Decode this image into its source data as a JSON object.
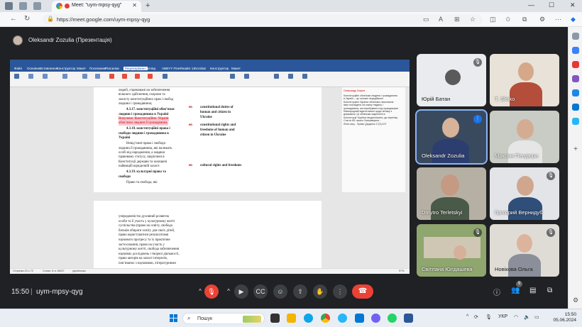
{
  "browser": {
    "tab_title": "Meet: \"uym-mpsy-qyg\"",
    "url": "https://meet.google.com/uym-mpsy-qyg"
  },
  "meet": {
    "presenter_label": "Oleksandr Zozulia (Презентація)",
    "time": "15:50",
    "separator": "|",
    "meeting_code": "uym-mpsy-qyg",
    "participants_count": "9",
    "participants": [
      {
        "name": "Юрій Батан",
        "muted": true
      },
      {
        "name": "T. Slinko",
        "muted": false
      },
      {
        "name": "Oleksandr Zozulia",
        "muted": false
      },
      {
        "name": "Максим Пендюра",
        "muted": false
      },
      {
        "name": "Dmytro Terletskyi",
        "muted": false
      },
      {
        "name": "Григорий Вернидуб",
        "muted": true
      },
      {
        "name": "Світлана Юлдашева",
        "muted": true
      },
      {
        "name": "Новікова Ольга",
        "muted": true
      }
    ]
  },
  "shared_doc": {
    "ribbon_tabs": [
      "Файл",
      "Основне",
      "Вставлення",
      "Конструктор",
      "Макет",
      "Посилання",
      "Розсилки",
      "Рецензування",
      "Вигляд",
      "ABBYY FineReader 12",
      "Acrobat",
      "Конструктор",
      "Макет"
    ],
    "active_tab_index": 7,
    "page1_lines": [
      "людей, спрямовані на забезпечення",
      "вільного здійснення, охорони та",
      "захисту конституційних прав і свобод",
      "людини і громадянина;",
      "4.3.17. конституційні обов’язки",
      "людини і громадянина в Україні",
      "Вилучено: Конституційне: Україні",
      "обов’язки людини й громадянина.",
      "4.3.18. конституційні права і",
      "свободи людини і громадянина в",
      "Україні",
      "Невід’ємні права і свободи",
      "людини й громадянина, які належать",
      "особі від народження, а завдяки",
      "правовому статусу, закріплені в",
      "Конституції держави та захищені",
      "найвищій юридичній захист.",
      "4.3.19. культурні права та",
      "свободи",
      "Право та свобода, які"
    ],
    "en_terms": [
      "constitutional duties of",
      "human and citizen in",
      "Ukraine",
      "constitutional rights and",
      "freedoms of human and",
      "citizen in Ukraine",
      "cultural rights and freedoms"
    ],
    "connector_words": [
      "en",
      "en",
      "en"
    ],
    "comment_author": "Олександр Зозуля",
    "comment_lines": [
      "Конституційні обов'язки людини і громадянина",
      "в Україні – це основні передбачені",
      "Конституцією України обов'язки, виконання",
      "яких покладено на кожну людину і",
      "громадянина, які перебувають під юрисдикцією",
      "Міжнародний юдичні вимог щодо зв'язку з",
      "державою. Ці обов'язки закріплені в",
      "Конституції України неоднозначно, до переліку",
      "Стаття 65: захист Батьківщини...",
      "Лінія часу - Право (Додаток 17(2):107"
    ],
    "page2_lines": [
      "упередженістю духовний розвиток",
      "особи та її участь у культурному житті",
      "суспільства (право на освіту, свобода",
      "батьків обирати освіту для своїх дітей,",
      "право користуватися результатами",
      "наукового прогресу та їх практичне",
      "застосування, право на участь у",
      "культурному житті, свобода забезпечення",
      "наукових досліджень і творчої діяльності,",
      "право авторів на захист інтересів,",
      "пов’язаних з науковими, літературними"
    ],
    "status_left": "Сторінка 23 з 72",
    "status_words": "Слово: 8 із 18627",
    "status_lang": "українська",
    "zoom": "97%"
  },
  "taskbar": {
    "search_placeholder": "Пошук",
    "language": "УКР",
    "time": "15:50",
    "date": "05.06.2024"
  }
}
